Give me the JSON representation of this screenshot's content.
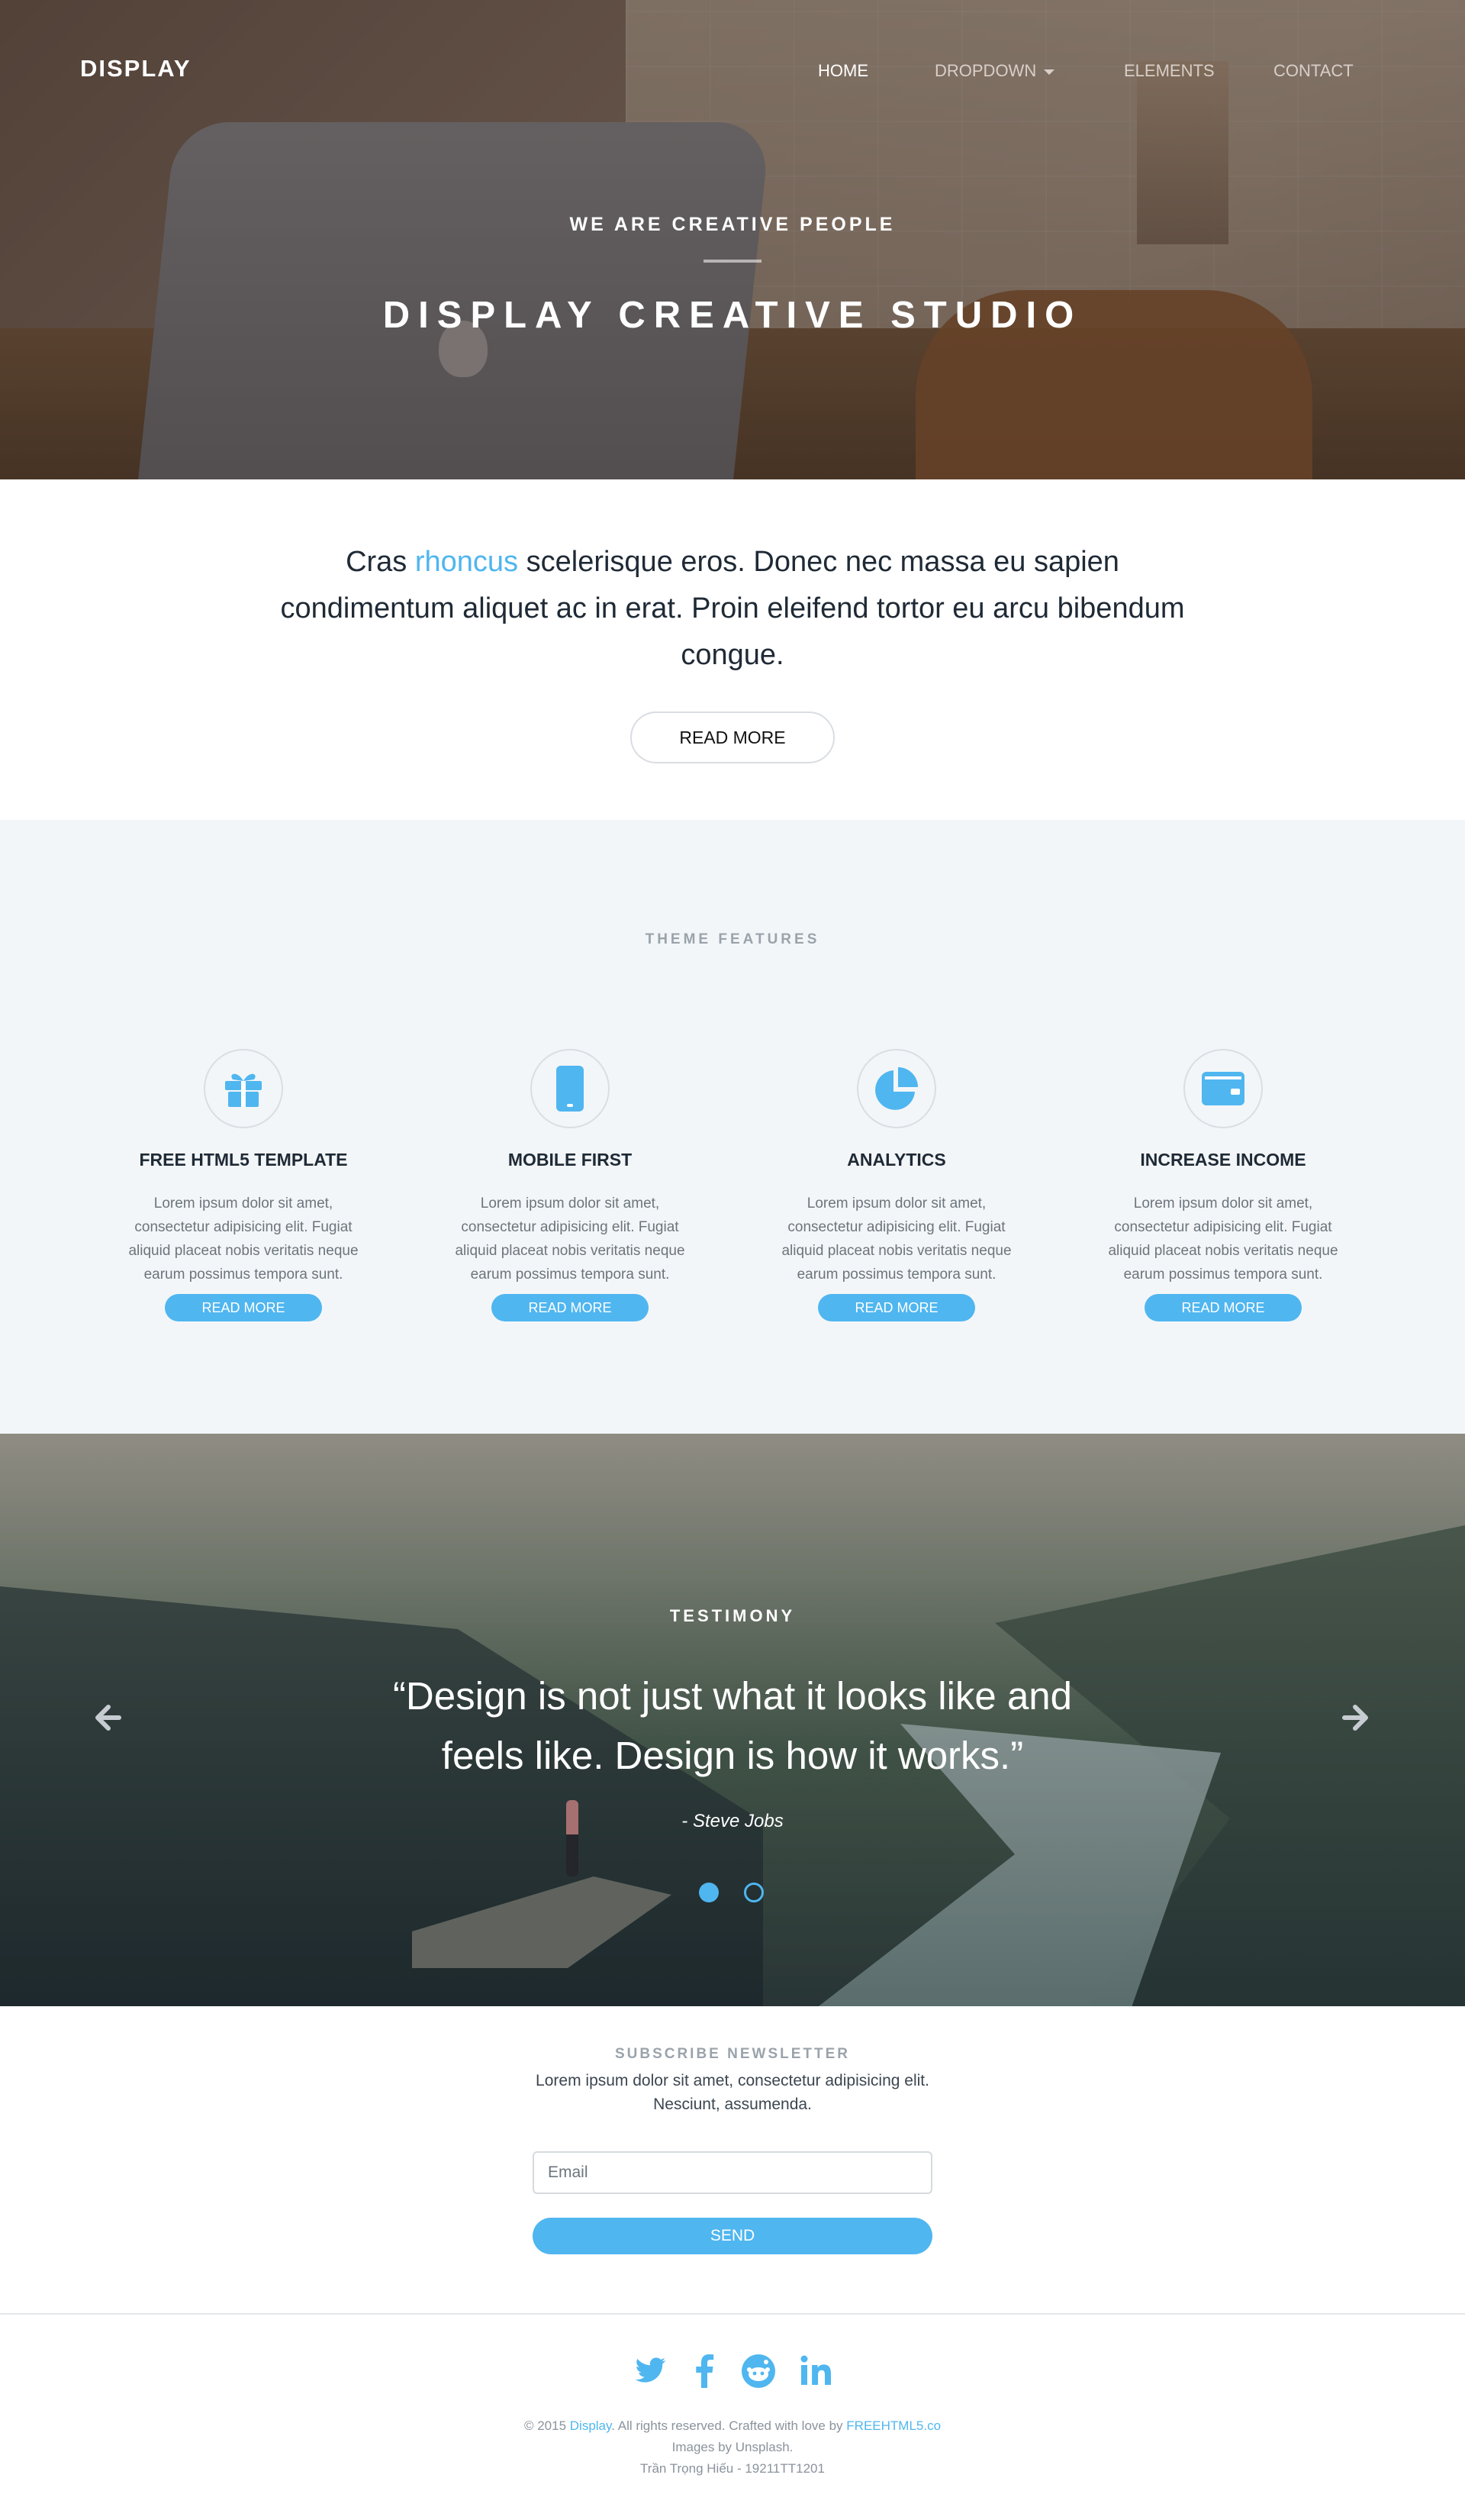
{
  "nav": {
    "brand": "DISPLAY",
    "items": [
      {
        "label": "HOME",
        "active": true
      },
      {
        "label": "DROPDOWN",
        "has_caret": true
      },
      {
        "label": "ELEMENTS"
      },
      {
        "label": "CONTACT"
      }
    ]
  },
  "hero": {
    "subtitle": "WE ARE CREATIVE PEOPLE",
    "title": "DISPLAY CREATIVE STUDIO"
  },
  "intro": {
    "text_before": "Cras ",
    "highlight": "rhoncus",
    "text_after": " scelerisque eros. Donec nec massa eu sapien condimentum aliquet ac in erat. Proin eleifend tortor eu arcu bibendum congue.",
    "button": "READ MORE"
  },
  "features": {
    "heading": "THEME FEATURES",
    "items": [
      {
        "icon": "gift-icon",
        "title": "FREE HTML5 TEMPLATE",
        "text": "Lorem ipsum dolor sit amet, consectetur adipisicing elit. Fugiat aliquid placeat nobis veritatis neque earum possimus tempora sunt.",
        "button": "READ MORE"
      },
      {
        "icon": "mobile-icon",
        "title": "MOBILE FIRST",
        "text": "Lorem ipsum dolor sit amet, consectetur adipisicing elit. Fugiat aliquid placeat nobis veritatis neque earum possimus tempora sunt.",
        "button": "READ MORE"
      },
      {
        "icon": "pie-chart-icon",
        "title": "ANALYTICS",
        "text": "Lorem ipsum dolor sit amet, consectetur adipisicing elit. Fugiat aliquid placeat nobis veritatis neque earum possimus tempora sunt.",
        "button": "READ MORE"
      },
      {
        "icon": "wallet-icon",
        "title": "INCREASE INCOME",
        "text": "Lorem ipsum dolor sit amet, consectetur adipisicing elit. Fugiat aliquid placeat nobis veritatis neque earum possimus tempora sunt.",
        "button": "READ MORE"
      }
    ]
  },
  "testimony": {
    "heading": "TESTIMONY",
    "quote": "“Design is not just what it looks like and feels like. Design is how it works.”",
    "author": "- Steve Jobs",
    "prev_icon": "arrow-left-icon",
    "next_icon": "arrow-right-icon",
    "slides": 2,
    "active_slide": 1
  },
  "newsletter": {
    "heading": "SUBSCRIBE NEWSLETTER",
    "text": "Lorem ipsum dolor sit amet, consectetur adipisicing elit. Nesciunt, assumenda.",
    "email_placeholder": "Email",
    "button": "SEND"
  },
  "footer": {
    "social": [
      "twitter-icon",
      "facebook-icon",
      "reddit-icon",
      "linkedin-icon"
    ],
    "copy_prefix": "© 2015 ",
    "copy_brand": "Display",
    "copy_middle": ". All rights reserved. Crafted with love by ",
    "copy_link": "FREEHTML5.co",
    "images_credit": "Images by Unsplash.",
    "author_credit": "Trần Trọng Hiếu - 19211TT1201"
  },
  "colors": {
    "accent": "#4fb6f0",
    "text_dark": "#1f2a36",
    "features_bg": "#f3f6f8"
  }
}
